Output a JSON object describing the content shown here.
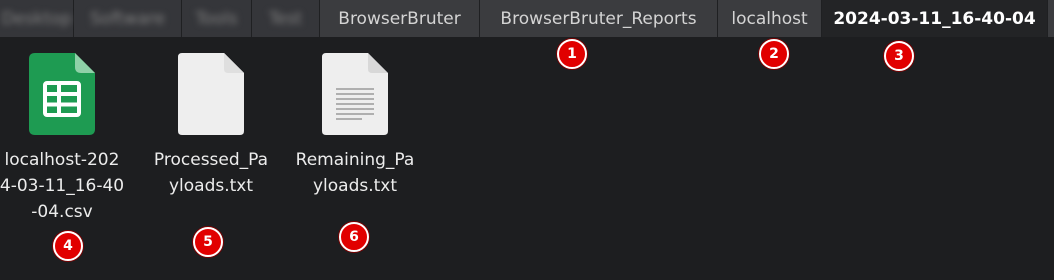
{
  "breadcrumbs": [
    {
      "label": "Desktop",
      "blurred": true
    },
    {
      "label": "Software",
      "blurred": true
    },
    {
      "label": "Tools",
      "blurred": true
    },
    {
      "label": "Test",
      "blurred": true
    },
    {
      "label": "BrowserBruter",
      "blurred": false
    },
    {
      "label": "BrowserBruter_Reports",
      "blurred": false
    },
    {
      "label": "localhost",
      "blurred": false
    },
    {
      "label": "2024-03-11_16-40-04",
      "blurred": false,
      "active": true
    }
  ],
  "files": [
    {
      "name_line1": "localhost-202",
      "name_line2": "4-03-11_16-40",
      "name_line3": "-04.csv",
      "icon": "spreadsheet-icon"
    },
    {
      "name_line1": "Processed_Pa",
      "name_line2": "yloads.txt",
      "icon": "blank-file-icon"
    },
    {
      "name_line1": "Remaining_Pa",
      "name_line2": "yloads.txt",
      "icon": "text-file-icon"
    }
  ],
  "markers": [
    "1",
    "2",
    "3",
    "4",
    "5",
    "6"
  ],
  "colors": {
    "marker": "#e10000",
    "spreadsheet": "#1e9b52",
    "file": "#eeeeee",
    "background": "#1d1e20"
  }
}
